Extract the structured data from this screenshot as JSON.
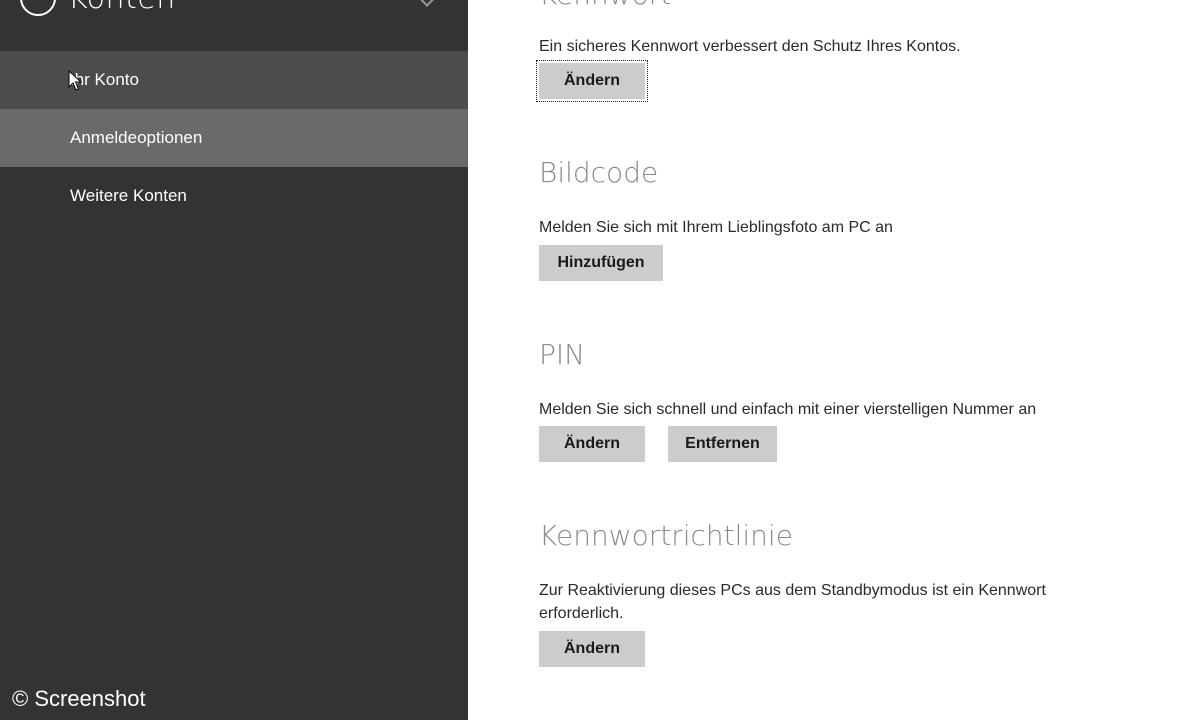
{
  "sidebar": {
    "title": "Konten",
    "items": [
      {
        "label": "Ihr Konto"
      },
      {
        "label": "Anmeldeoptionen"
      },
      {
        "label": "Weitere Konten"
      }
    ]
  },
  "sections": {
    "kennwort": {
      "title": "Kennwort",
      "description": "Ein sicheres Kennwort verbessert den Schutz Ihres Kontos.",
      "change_button": "Ändern"
    },
    "bildcode": {
      "title": "Bildcode",
      "description": "Melden Sie sich mit Ihrem Lieblingsfoto am PC an",
      "add_button": "Hinzufügen"
    },
    "pin": {
      "title": "PIN",
      "description": "Melden Sie sich schnell und einfach mit einer vierstelligen Nummer an",
      "change_button": "Ändern",
      "remove_button": "Entfernen"
    },
    "kennwortrichtlinie": {
      "title": "Kennwortrichtlinie",
      "description": "Zur Reaktivierung dieses PCs aus dem Standbymodus ist ein Kennwort erforderlich.",
      "change_button": "Ändern"
    }
  },
  "watermark": "© Screenshot",
  "colors": {
    "sidebar_bg": "#333333",
    "nav_selected": "#6a6a6a",
    "nav_hover": "#4c4c4c",
    "button_bg": "#cccccc",
    "heading": "#8a8a8a"
  }
}
